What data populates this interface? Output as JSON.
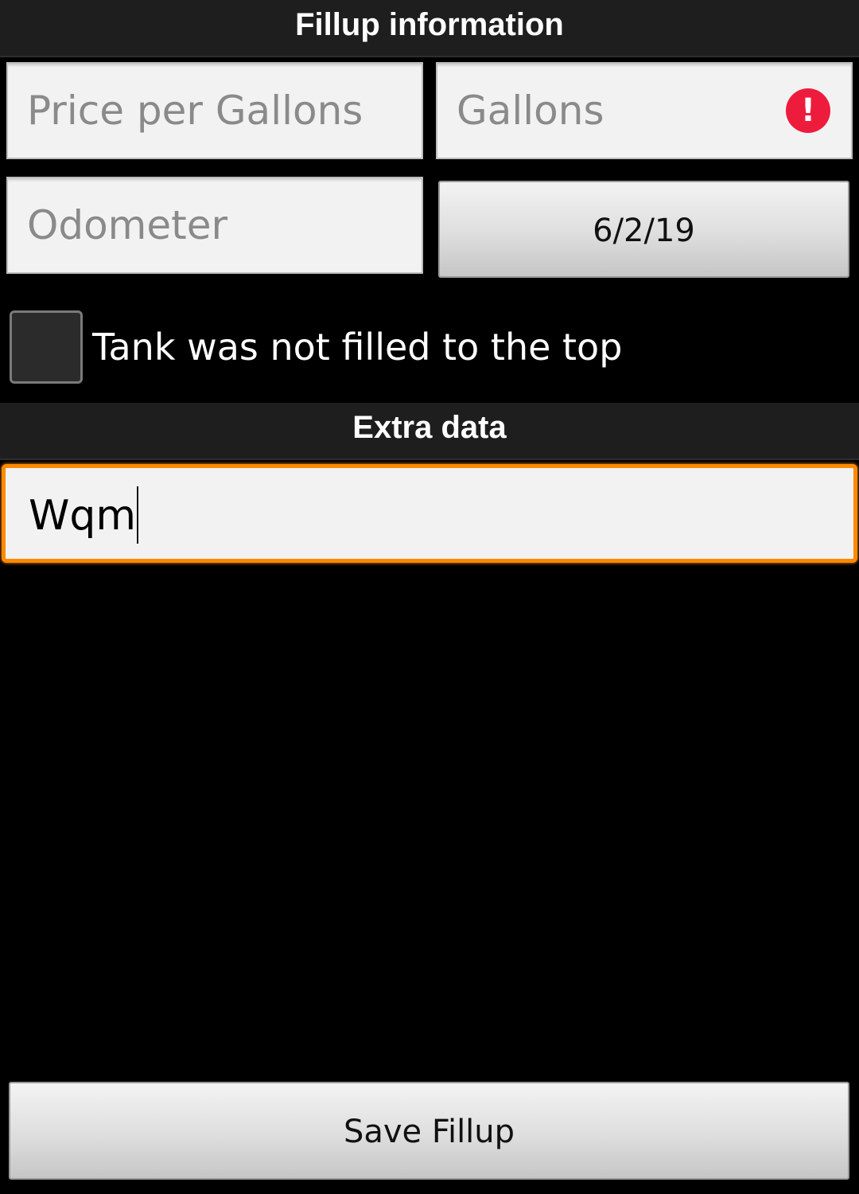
{
  "headers": {
    "fillup_info": "Fillup information",
    "extra_data": "Extra data"
  },
  "fields": {
    "price_per_gallons": {
      "placeholder": "Price per Gallons",
      "value": ""
    },
    "gallons": {
      "placeholder": "Gallons",
      "value": "",
      "error_icon": "!"
    },
    "odometer": {
      "placeholder": "Odometer",
      "value": ""
    }
  },
  "date_button": {
    "label": "6/2/19"
  },
  "tank_checkbox": {
    "label": "Tank was not filled to the top",
    "checked": false
  },
  "extra_field": {
    "value": "Wqm"
  },
  "save_button": {
    "label": "Save Fillup"
  },
  "colors": {
    "focus_accent": "#ff8a00",
    "error": "#ee1c3c",
    "header_bg": "#1e1e1e"
  },
  "icons": {
    "gallons_error": "error-icon"
  }
}
